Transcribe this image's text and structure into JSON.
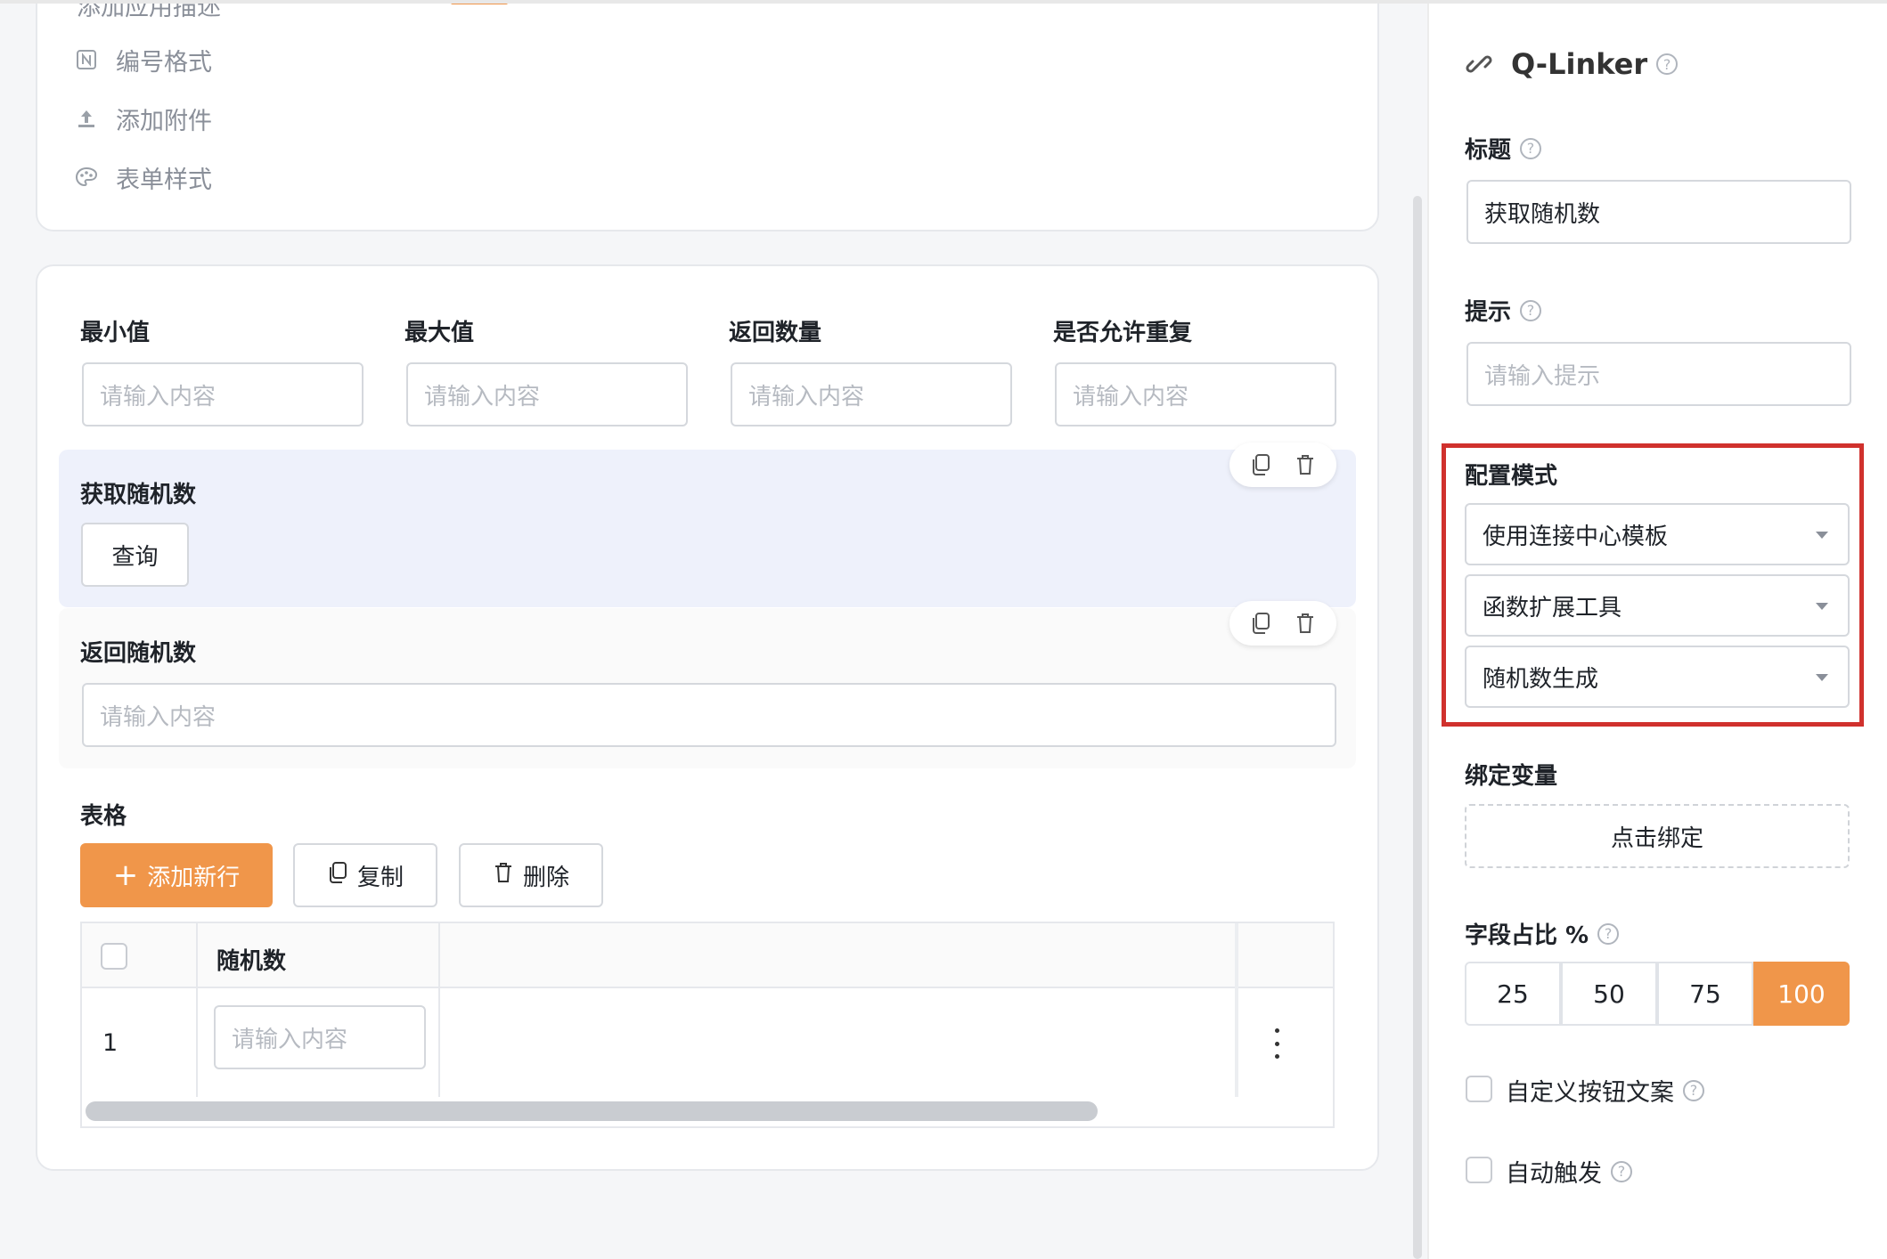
{
  "top_card": {
    "partial_item": "添加应用描述",
    "menu": [
      {
        "label": "编号格式",
        "icon": "number-format-icon"
      },
      {
        "label": "添加附件",
        "icon": "upload-icon"
      },
      {
        "label": "表单样式",
        "icon": "palette-icon"
      }
    ]
  },
  "form": {
    "fields": [
      {
        "label": "最小值",
        "placeholder": "请输入内容"
      },
      {
        "label": "最大值",
        "placeholder": "请输入内容"
      },
      {
        "label": "返回数量",
        "placeholder": "请输入内容"
      },
      {
        "label": "是否允许重复",
        "placeholder": "请输入内容"
      }
    ],
    "random_block": {
      "title": "获取随机数",
      "query_button": "查询"
    },
    "return_block": {
      "title": "返回随机数",
      "placeholder": "请输入内容"
    },
    "table": {
      "title": "表格",
      "add_row": "添加新行",
      "copy": "复制",
      "delete": "删除",
      "column": "随机数",
      "rows": [
        {
          "index": "1",
          "placeholder": "请输入内容"
        }
      ]
    }
  },
  "panel": {
    "brand": "Q-Linker",
    "title_label": "标题",
    "title_value": "获取随机数",
    "hint_label": "提示",
    "hint_placeholder": "请输入提示",
    "config_label": "配置模式",
    "config_selects": [
      "使用连接中心模板",
      "函数扩展工具",
      "随机数生成"
    ],
    "bind_label": "绑定变量",
    "bind_button": "点击绑定",
    "ratio_label": "字段占比 %",
    "ratio_options": [
      "25",
      "50",
      "75",
      "100"
    ],
    "ratio_selected": "100",
    "custom_button_label": "自定义按钮文案",
    "auto_trigger_label": "自动触发"
  },
  "colors": {
    "accent": "#f0964a",
    "highlight_border": "#d0312d",
    "selected_block_bg": "#eef1fb"
  }
}
